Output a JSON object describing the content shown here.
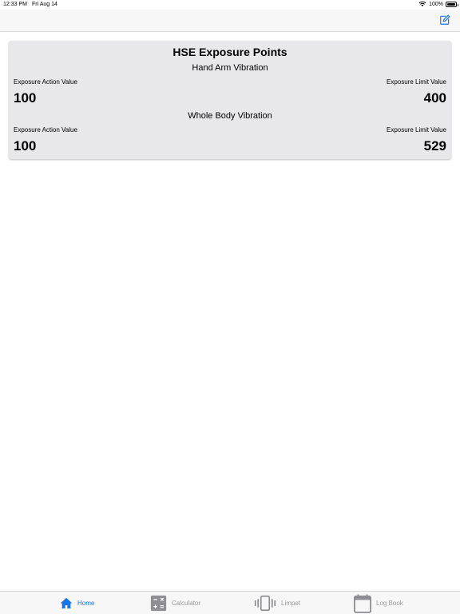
{
  "status_bar": {
    "time": "12:33 PM",
    "date": "Fri Aug 14",
    "battery": "100%"
  },
  "navbar": {
    "compose_icon": "compose-icon"
  },
  "card": {
    "title": "HSE Exposure Points",
    "sections": [
      {
        "title": "Hand Arm Vibration",
        "action_label": "Exposure Action Value",
        "action_value": "100",
        "limit_label": "Exposure Limit Value",
        "limit_value": "400"
      },
      {
        "title": "Whole Body Vibration",
        "action_label": "Exposure Action Value",
        "action_value": "100",
        "limit_label": "Exposure Limit Value",
        "limit_value": "529"
      }
    ]
  },
  "tabs": [
    {
      "label": "Home",
      "icon": "home-icon",
      "active": true
    },
    {
      "label": "Calculator",
      "icon": "calculator-icon",
      "active": false
    },
    {
      "label": "Limpet",
      "icon": "vibration-icon",
      "active": false
    },
    {
      "label": "Log Book",
      "icon": "calendar-icon",
      "active": false
    }
  ],
  "colors": {
    "accent": "#1a73e8",
    "inactive": "#8e8e93",
    "card_bg": "#e8e8ea"
  }
}
